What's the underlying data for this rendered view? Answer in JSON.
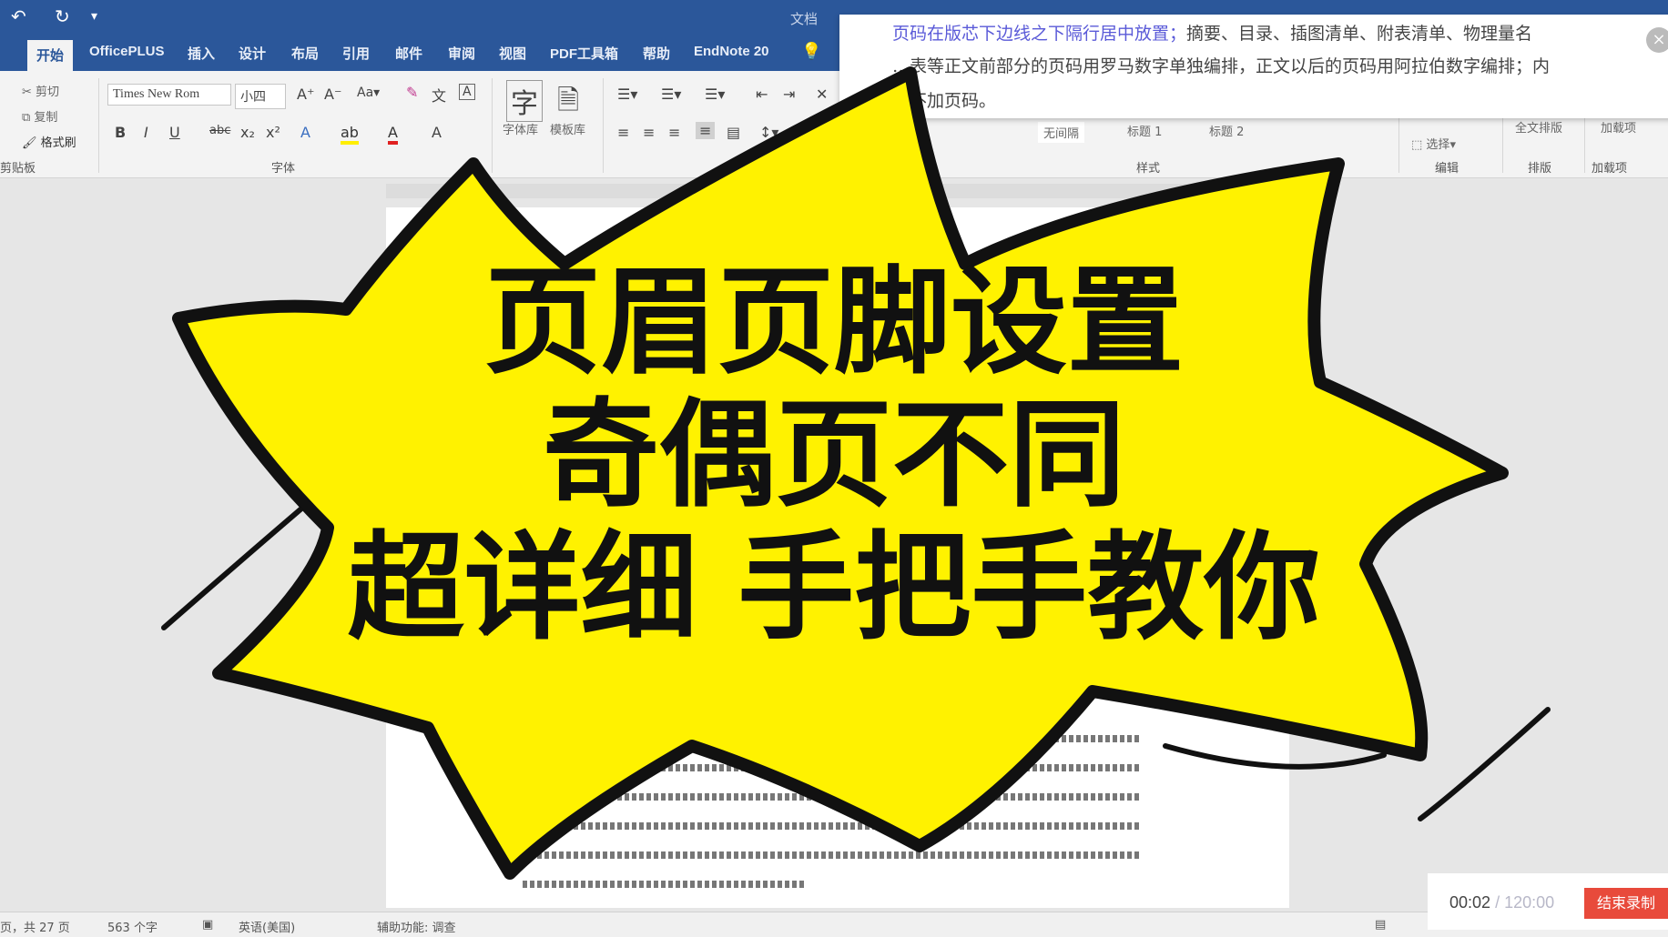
{
  "title_bar": {
    "doc_title": "文档"
  },
  "tabs": [
    "开始",
    "OfficePLUS",
    "插入",
    "设计",
    "布局",
    "引用",
    "邮件",
    "审阅",
    "视图",
    "PDF工具箱",
    "帮助",
    "EndNote 20"
  ],
  "active_tab": "开始",
  "ribbon": {
    "clipboard": {
      "cut": "剪切",
      "copy": "复制",
      "format_painter": "格式刷",
      "label": "剪贴板"
    },
    "font": {
      "font_name": "Times New Rom",
      "font_size": "小四",
      "label": "字体"
    },
    "font_lib": "字体库",
    "template_lib": "模板库",
    "styles": {
      "items": [
        "无间隔",
        "标题 1",
        "标题 2"
      ],
      "label": "样式"
    },
    "editing": {
      "select": "选择",
      "label": "编辑"
    },
    "layout_label": "排版",
    "full_layout": "全文排版",
    "addins": {
      "label": "加载项",
      "item": "加载项"
    }
  },
  "popup": {
    "line1_highlight": "页码在版芯下边线之下隔行居中放置；",
    "line1_rest": "摘要、目录、插图清单、附表清单、物理量名",
    "line2": "…表等正文前部分的页码用罗马数字单独编排，正文以后的页码用阿拉伯数字编排；内",
    "line3": "…不加页码。"
  },
  "overlay": {
    "line1": "页眉页脚设置",
    "line2": "奇偶页不同",
    "line3": "超详细 手把手教你",
    "burst_color": "#fff200"
  },
  "status_bar": {
    "pages": "页，共 27 页",
    "words": "563 个字",
    "language": "英语(美国)",
    "accessibility": "辅助功能: 调查"
  },
  "recorder": {
    "elapsed": "00:02",
    "total": "/ 120:00",
    "stop_label": "结束录制",
    "stop_color": "#e84a3b"
  }
}
